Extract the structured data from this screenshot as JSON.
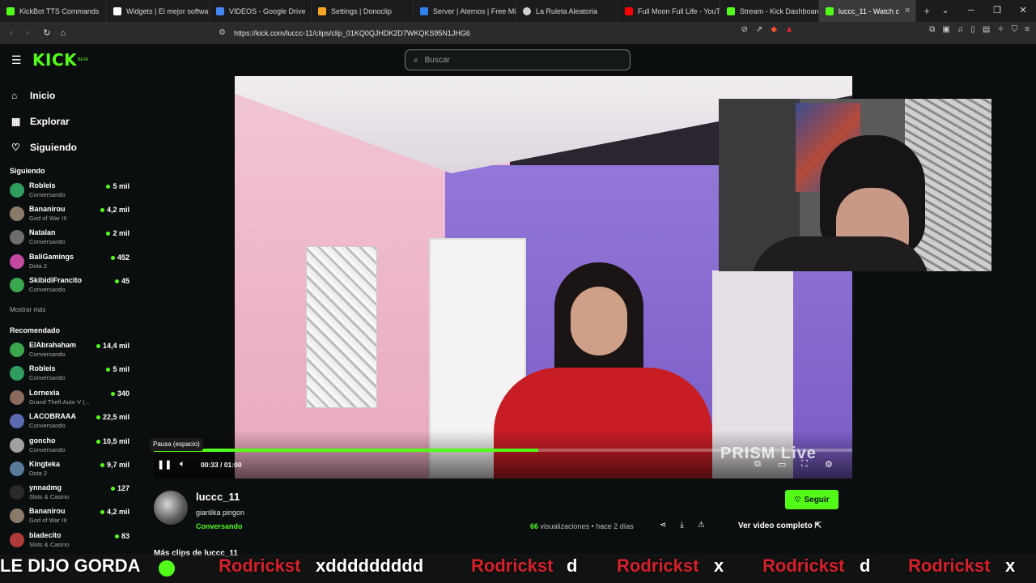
{
  "browser": {
    "tabs": [
      {
        "label": "KickBot TTS Commands",
        "color": "#53fc18",
        "active": false
      },
      {
        "label": "Widgets | El mejor softwa",
        "color": "#ffffff",
        "active": false
      },
      {
        "label": "VIDEOS - Google Drive",
        "color": "#4285f4",
        "active": false
      },
      {
        "label": "Settings | Donoclip",
        "color": "#f5a623",
        "active": false
      },
      {
        "label": "Server | Aternos | Free Mi",
        "color": "#2f80ed",
        "active": false
      },
      {
        "label": "La Ruleta Aleatoria",
        "color": "#cfcfcf",
        "active": false
      },
      {
        "label": "Full Moon Full Life - YouTu",
        "color": "#ff0000",
        "active": false
      },
      {
        "label": "Stream - Kick Dashboard",
        "color": "#53fc18",
        "active": false
      },
      {
        "label": "luccc_11 - Watch c",
        "color": "#53fc18",
        "active": true
      }
    ],
    "url": "https://kick.com/luccc-11/clips/clip_01KQ0QJHDK2D7WKQKS95N1JHG6"
  },
  "kick": {
    "logo": "KICK",
    "logo_badge": "BETA",
    "search_placeholder": "Buscar",
    "nav": [
      {
        "label": "Inicio",
        "icon": "home-icon"
      },
      {
        "label": "Explorar",
        "icon": "compass-icon"
      },
      {
        "label": "Siguiendo",
        "icon": "heart-icon"
      }
    ],
    "following_title": "Siguiendo",
    "following": [
      {
        "name": "Robleis",
        "category": "Conversando",
        "viewers": "5 mil",
        "color": "#2f9d5d"
      },
      {
        "name": "Bananirou",
        "category": "God of War III",
        "viewers": "4,2 mil",
        "color": "#8a7a6a"
      },
      {
        "name": "Natalan",
        "category": "Conversando",
        "viewers": "2 mil",
        "color": "#6d6d6d"
      },
      {
        "name": "BaliGamings",
        "category": "Dota 2",
        "viewers": "452",
        "color": "#c34aa0"
      },
      {
        "name": "SkibidiFrancito",
        "category": "Conversando",
        "viewers": "45",
        "color": "#3aa64e"
      }
    ],
    "show_more": "Mostrar más",
    "recommended_title": "Recomendado",
    "recommended": [
      {
        "name": "ElAbrahaham",
        "category": "Conversando",
        "viewers": "14,4 mil",
        "color": "#3aa64e"
      },
      {
        "name": "Robleis",
        "category": "Conversando",
        "viewers": "5 mil",
        "color": "#2f9d5d"
      },
      {
        "name": "Lornexia",
        "category": "Grand Theft Auto V (...",
        "viewers": "340",
        "color": "#8a6a5a"
      },
      {
        "name": "LACOBRAAA",
        "category": "Conversando",
        "viewers": "22,5 mil",
        "color": "#5a6ab0"
      },
      {
        "name": "goncho",
        "category": "Conversando",
        "viewers": "10,5 mil",
        "color": "#a0a0a0"
      },
      {
        "name": "Kingteka",
        "category": "Dota 2",
        "viewers": "9,7 mil",
        "color": "#5a7a9a"
      },
      {
        "name": "ynnadmg",
        "category": "Slots & Casino",
        "viewers": "127",
        "color": "#2a2a2a"
      },
      {
        "name": "Bananirou",
        "category": "God of War III",
        "viewers": "4,2 mil",
        "color": "#8a7a6a"
      },
      {
        "name": "bladecito",
        "category": "Slots & Casino",
        "viewers": "83",
        "color": "#b03a3a"
      }
    ],
    "player": {
      "tooltip": "Pausa (espacio)",
      "time": "00:33 / 01:00",
      "progress": 0.55,
      "watermark": "PRISM Live"
    },
    "clip": {
      "streamer": "luccc_11",
      "title": "gianlika pingon",
      "category": "Conversando",
      "follow_label": "Seguir",
      "views": "66",
      "views_label": "visualizaciones",
      "age": "• hace 2 días",
      "watch_full": "Ver video completo",
      "more_clips": "Más clips de luccc_11"
    }
  },
  "overlay": {
    "left_text": "LE DIJO GORDA",
    "ticker": [
      {
        "user": "Rodrickst",
        "msg": "xddddddddd"
      },
      {
        "user": "Rodrickst",
        "msg": "d"
      },
      {
        "user": "Rodrickst",
        "msg": "x"
      },
      {
        "user": "Rodrickst",
        "msg": "d"
      },
      {
        "user": "Rodrickst",
        "msg": "x"
      }
    ]
  }
}
